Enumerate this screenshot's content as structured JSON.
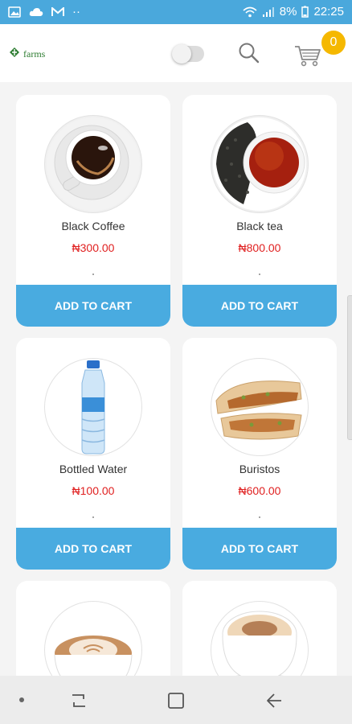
{
  "status_bar": {
    "battery_percent": "8%",
    "time": "22:25",
    "dots": "··"
  },
  "header": {
    "logo_text": "farms",
    "cart_count": "0"
  },
  "products": [
    {
      "name": "Black Coffee",
      "price": "₦300.00",
      "button": "ADD TO CART"
    },
    {
      "name": "Black tea",
      "price": "₦800.00",
      "button": "ADD TO CART"
    },
    {
      "name": "Bottled Water",
      "price": "₦100.00",
      "button": "ADD TO CART"
    },
    {
      "name": "Buristos",
      "price": "₦600.00",
      "button": "ADD TO CART"
    }
  ],
  "colors": {
    "status_bar": "#4aa8dc",
    "button": "#49abe0",
    "price": "#e02020",
    "badge": "#f5b800",
    "logo": "#2e7d32"
  },
  "icons": [
    "photo-icon",
    "cloud-icon",
    "gmail-icon",
    "wifi-icon",
    "signal-icon",
    "battery-icon",
    "search-icon",
    "cart-icon",
    "recents-icon",
    "home-icon",
    "back-icon"
  ]
}
